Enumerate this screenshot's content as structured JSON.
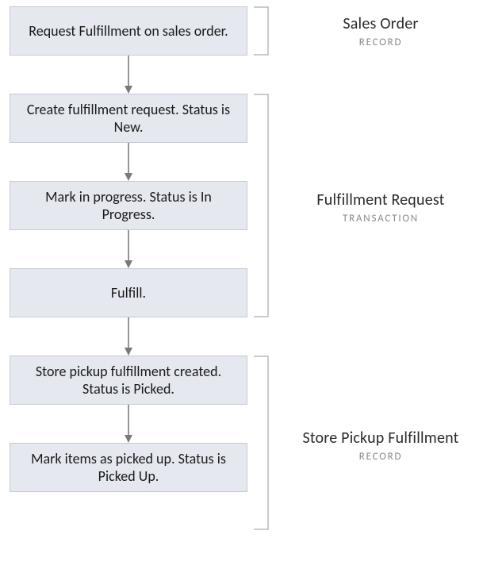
{
  "steps": [
    {
      "text": "Request Fulfillment on sales order."
    },
    {
      "text": "Create fulfillment request. Status is New."
    },
    {
      "text": "Mark in progress. Status is In Progress."
    },
    {
      "text": "Fulfill."
    },
    {
      "text": "Store pickup fulfillment created. Status is Picked."
    },
    {
      "text": "Mark items as picked up. Status is Picked Up."
    }
  ],
  "groups": [
    {
      "title": "Sales Order",
      "subtitle": "RECORD"
    },
    {
      "title": "Fulfillment Request",
      "subtitle": "TRANSACTION"
    },
    {
      "title": "Store Pickup Fulfillment",
      "subtitle": "RECORD"
    }
  ],
  "colors": {
    "box_bg": "#e6e8f0",
    "box_border": "#c8cad4",
    "arrow": "#7a7a7a",
    "bracket": "#b8bac2",
    "subtitle": "#8a8a8a"
  }
}
